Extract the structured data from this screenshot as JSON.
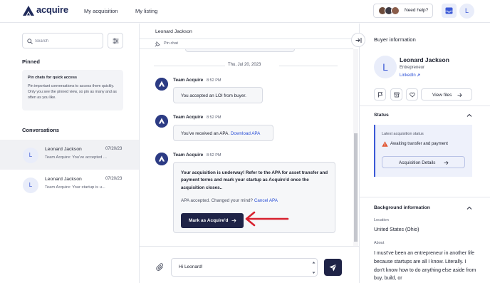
{
  "app": {
    "brand": "acquire"
  },
  "topnav": {
    "items": [
      {
        "label": "My acquisition"
      },
      {
        "label": "My listing"
      }
    ]
  },
  "header": {
    "help_label": "Need help?",
    "user_initial": "L"
  },
  "sidebar": {
    "search_placeholder": "Search",
    "pinned_title": "Pinned",
    "pin_card_title": "Pin chats for quick access",
    "pin_card_desc": "Pin important conversations to access them quickly. Only you see the pinned view, so pin as many and as often as you like.",
    "conversations_title": "Conversations",
    "conversations": [
      {
        "initial": "L",
        "name": "Leonard Jackson",
        "date": "07/20/23",
        "preview": "Team Acquire: You've accepted ...",
        "active": true
      },
      {
        "initial": "L",
        "name": "Leonard Jackson",
        "date": "07/20/23",
        "preview": "Team Acquire: Your startup is u...",
        "active": false
      }
    ]
  },
  "chat": {
    "contact_name": "Leonard Jackson",
    "pin_label": "Pin chat",
    "date_divider": "Thu, Jul 20, 2023",
    "messages": [
      {
        "sender": "Team Acquire",
        "time": "8:52 PM",
        "text": "You accepted an LOI from buyer."
      },
      {
        "sender": "Team Acquire",
        "time": "8:52 PM",
        "text": "You've received an APA.",
        "link": "Download APA"
      },
      {
        "sender": "Team Acquire",
        "time": "8:52 PM",
        "bold_text": "Your acquisition is underway! Refer to the APA for asset transfer and payment terms and mark your startup as Acquire'd once the acquisition closes..",
        "note": "APA accepted. Changed your mind?",
        "note_link": "Cancel APA",
        "cta": "Mark as Acquire'd"
      }
    ],
    "compose_value": "Hi Leonard!"
  },
  "buyer": {
    "title": "Buyer information",
    "initial": "L",
    "name": "Leonard Jackson",
    "role": "Entrepreneur",
    "link": "LinkedIn",
    "view_files": "View files",
    "status_title": "Status",
    "status_label": "Latest acquisition status",
    "status_value": "Awaiting transfer and payment",
    "details_btn": "Acquisition Details",
    "background_title": "Background information",
    "location_label": "Location",
    "location_value": "United States (Ohio)",
    "about_label": "About",
    "about_text": "I must've been an entrepreneur in another life because startups are all I know. Literally. I don't know how to do anything else aside from buy, build, or"
  },
  "colors": {
    "brand": "#1f2a5a",
    "accent": "#3b59d6",
    "cta": "#1f2347",
    "annotation": "#d8212f",
    "warning": "#e0532f"
  }
}
